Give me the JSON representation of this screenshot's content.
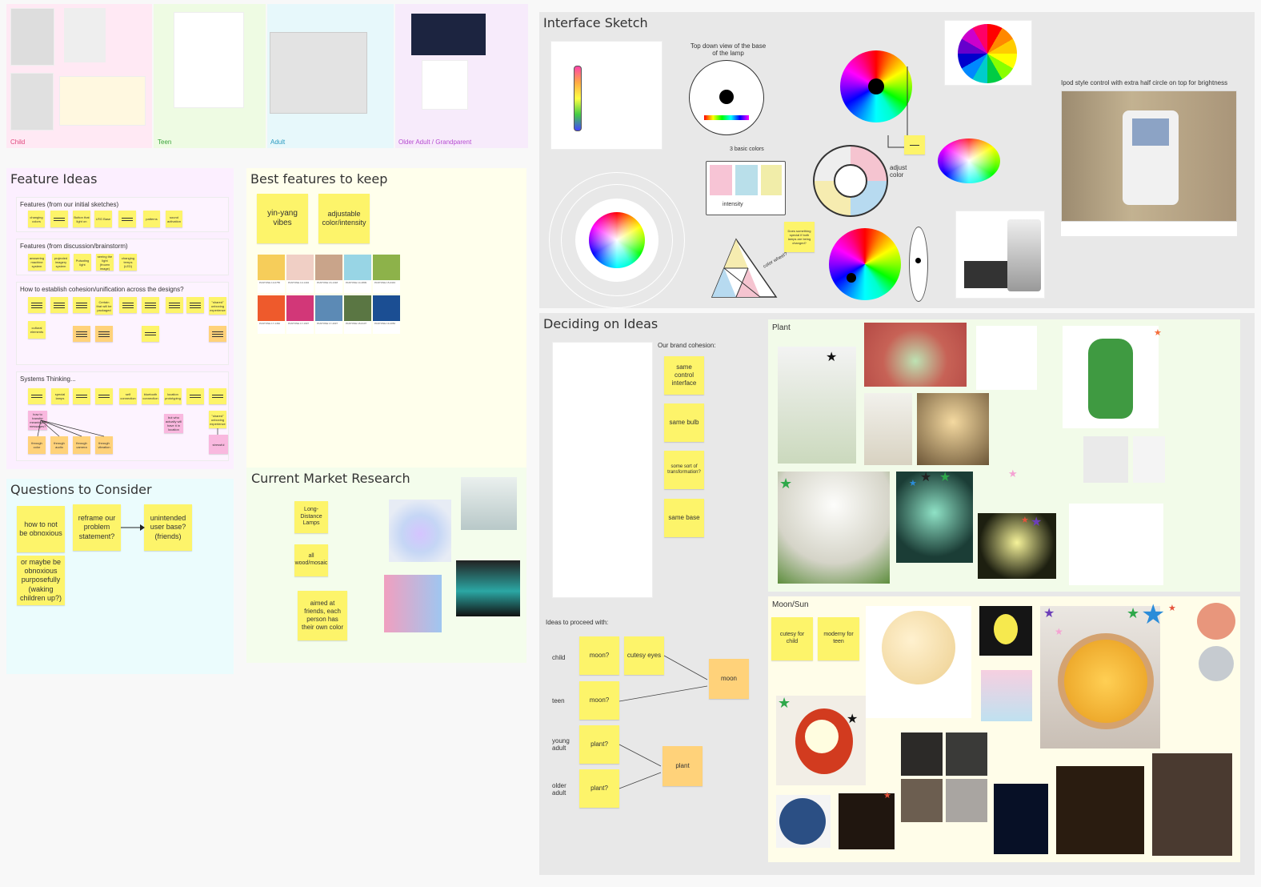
{
  "personas": {
    "child": "Child",
    "teen": "Teen",
    "adult": "Adult",
    "older": "Older Adult / Grandparent"
  },
  "feature_ideas": {
    "title": "Feature Ideas",
    "sub1": "Features (from our initial sketches)",
    "sub2": "Features (from discussion/brainstorm)",
    "sub3": "How to establish cohesion/unification across the designs?",
    "sub4": "Systems Thinking..."
  },
  "best_features": {
    "title": "Best features to keep",
    "notes": [
      "yin-yang vibes",
      "adjustable color/intensity"
    ]
  },
  "questions": {
    "title": "Questions to Consider",
    "notes": [
      "how to not be obnoxious",
      "reframe our problem statement?",
      "unintended user base? (friends)",
      "or maybe be obnoxious purposefully (waking children up?)"
    ]
  },
  "market": {
    "title": "Current Market Research",
    "notes": [
      "Long-Distance Lamps",
      "all wood/mosaic",
      "aimed at friends, each person has their own color"
    ]
  },
  "interface": {
    "title": "Interface Sketch",
    "top_down": "Top down view of the base of the lamp",
    "ipod_caption": "Ipod style control with extra half circle on top for brightness",
    "basic_colors": "3 basic colors",
    "intensity": "intensity",
    "adjust_color": "adjust color",
    "color_wheel": "color wheel?",
    "does_note": "Does something special if both lamps are being changed?"
  },
  "deciding": {
    "title": "Deciding on Ideas",
    "brand_cohesion": "Our brand cohesion:",
    "cohesion_notes": [
      "same control interface",
      "same bulb",
      "some sort of transformation?",
      "same base"
    ],
    "proceed": "Ideas to proceed with:",
    "rows": [
      "child",
      "teen",
      "young adult",
      "older adult"
    ],
    "picks": [
      "moon?",
      "cutesy eyes",
      "moon?",
      "plant?",
      "plant?"
    ],
    "results": [
      "moon",
      "plant"
    ]
  },
  "plant": {
    "title": "Plant"
  },
  "moon": {
    "title": "Moon/Sun",
    "notes": [
      "cutesy for child",
      "moderny for teen"
    ]
  },
  "colors": {
    "yellow": "#fdf46a",
    "orange": "#ffd27a",
    "pink": "#f9b8df"
  }
}
